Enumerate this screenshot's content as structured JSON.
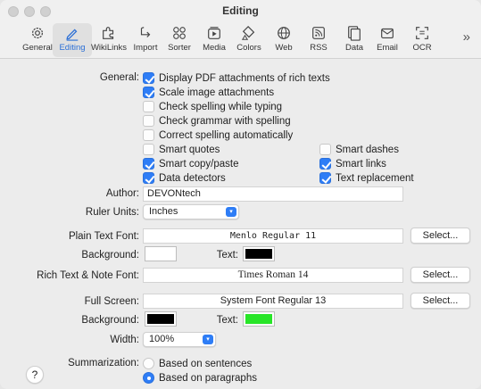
{
  "window": {
    "title": "Editing"
  },
  "toolbar": {
    "items": [
      {
        "label": "General",
        "icon": "gear-icon"
      },
      {
        "label": "Editing",
        "icon": "pencil-icon"
      },
      {
        "label": "WikiLinks",
        "icon": "puzzle-icon"
      },
      {
        "label": "Import",
        "icon": "import-icon"
      },
      {
        "label": "Sorter",
        "icon": "sorter-icon"
      },
      {
        "label": "Media",
        "icon": "media-icon"
      },
      {
        "label": "Colors",
        "icon": "paint-bucket-icon"
      },
      {
        "label": "Web",
        "icon": "globe-icon"
      },
      {
        "label": "RSS",
        "icon": "rss-icon"
      },
      {
        "label": "Data",
        "icon": "data-icon"
      },
      {
        "label": "Email",
        "icon": "envelope-icon"
      },
      {
        "label": "OCR",
        "icon": "ocr-icon"
      }
    ],
    "active": "Editing",
    "overflow": "»"
  },
  "general": {
    "label": "General:",
    "options": [
      {
        "label": "Display PDF attachments of rich texts",
        "checked": true
      },
      {
        "label": "Scale image attachments",
        "checked": true
      },
      {
        "label": "Check spelling while typing",
        "checked": false
      },
      {
        "label": "Check grammar with spelling",
        "checked": false
      },
      {
        "label": "Correct spelling automatically",
        "checked": false
      },
      {
        "label": "Smart quotes",
        "checked": false
      },
      {
        "label": "Smart dashes",
        "checked": false
      },
      {
        "label": "Smart copy/paste",
        "checked": true
      },
      {
        "label": "Smart links",
        "checked": true
      },
      {
        "label": "Data detectors",
        "checked": true
      },
      {
        "label": "Text replacement",
        "checked": true
      }
    ]
  },
  "author": {
    "label": "Author:",
    "value": "DEVONtech"
  },
  "ruler_units": {
    "label": "Ruler Units:",
    "value": "Inches"
  },
  "plain_text_font": {
    "label": "Plain Text Font:",
    "value": "Menlo Regular 11",
    "button": "Select..."
  },
  "plain_colors": {
    "background_label": "Background:",
    "background": "#ffffff",
    "text_label": "Text:",
    "text": "#000000"
  },
  "rich_text_font": {
    "label": "Rich Text & Note Font:",
    "value": "Times Roman 14",
    "button": "Select..."
  },
  "full_screen": {
    "label": "Full Screen:",
    "value": "System Font Regular 13",
    "button": "Select..."
  },
  "full_colors": {
    "background_label": "Background:",
    "background": "#000000",
    "text_label": "Text:",
    "text": "#28e528"
  },
  "width": {
    "label": "Width:",
    "value": "100%"
  },
  "summarization": {
    "label": "Summarization:",
    "options": [
      {
        "label": "Based on sentences",
        "selected": false
      },
      {
        "label": "Based on paragraphs",
        "selected": true
      }
    ]
  },
  "help": {
    "label": "?"
  },
  "colors": {
    "accent": "#2e7df6"
  }
}
